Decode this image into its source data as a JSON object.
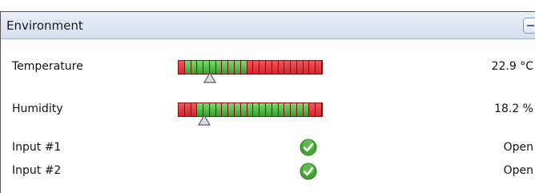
{
  "panel": {
    "title": "Environment",
    "collapse_icon": "minus-icon"
  },
  "sensors": [
    {
      "label": "Temperature",
      "value": "22.9 °C",
      "gauge": {
        "segments": [
          "red",
          "green",
          "green",
          "green",
          "green",
          "green",
          "green",
          "green",
          "green",
          "green",
          "green",
          "red",
          "red",
          "red",
          "red",
          "red",
          "red",
          "red",
          "red",
          "red",
          "red",
          "red",
          "red"
        ],
        "marker_fraction": 0.22
      }
    },
    {
      "label": "Humidity",
      "value": "18.2 %",
      "gauge": {
        "segments": [
          "red",
          "red",
          "red",
          "green",
          "green",
          "green",
          "green",
          "green",
          "green",
          "green",
          "green",
          "green",
          "green",
          "green",
          "green",
          "green",
          "green",
          "green",
          "green",
          "green",
          "green",
          "red",
          "red"
        ],
        "marker_fraction": 0.18
      }
    }
  ],
  "inputs": [
    {
      "label": "Input #1",
      "status": "Open",
      "icon": "check-icon"
    },
    {
      "label": "Input #2",
      "status": "Open",
      "icon": "check-icon"
    }
  ],
  "colors": {
    "ok": "#3ea82e",
    "alarm": "#d8262e",
    "header_bg": "#dfe7f3"
  }
}
